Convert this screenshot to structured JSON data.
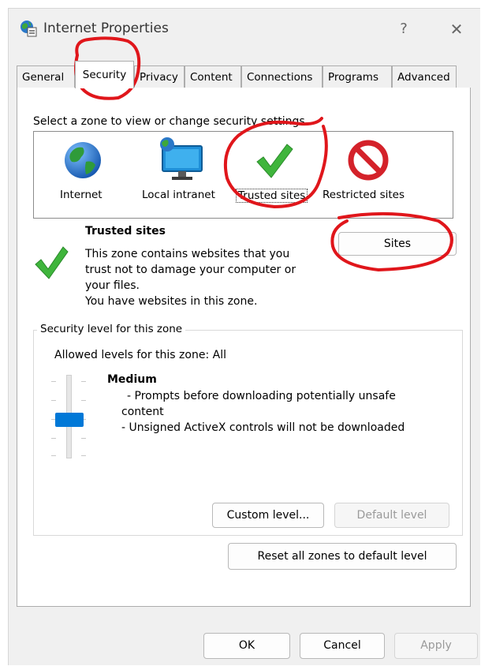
{
  "window": {
    "title": "Internet Properties",
    "help_glyph": "?",
    "close_glyph": "✕",
    "icon": "globe-internet-options-icon"
  },
  "tabs": [
    {
      "label": "General",
      "active": false
    },
    {
      "label": "Security",
      "active": true
    },
    {
      "label": "Privacy",
      "active": false
    },
    {
      "label": "Content",
      "active": false
    },
    {
      "label": "Connections",
      "active": false
    },
    {
      "label": "Programs",
      "active": false
    },
    {
      "label": "Advanced",
      "active": false
    }
  ],
  "security": {
    "zone_prompt": "Select a zone to view or change security settings.",
    "zones": [
      {
        "label": "Internet",
        "icon": "globe-icon"
      },
      {
        "label": "Local intranet",
        "icon": "intranet-monitor-icon"
      },
      {
        "label": "Trusted sites",
        "icon": "green-checkmark-icon",
        "selected": true
      },
      {
        "label": "Restricted sites",
        "icon": "no-entry-icon"
      }
    ],
    "selected_zone": {
      "name": "Trusted sites",
      "description_lines": [
        "This zone contains websites that you",
        "trust not to damage your computer or",
        "your files.",
        "You have websites in this zone."
      ]
    },
    "sites_button": "Sites",
    "level_group_title": "Security level for this zone",
    "allowed_levels": "Allowed levels for this zone: All",
    "level": {
      "name": "Medium",
      "lines": [
        "- Prompts before downloading potentially unsafe",
        "content",
        "- Unsigned ActiveX controls will not be downloaded"
      ],
      "slider_position": "medium"
    },
    "custom_level_button": "Custom level...",
    "default_level_button": "Default level",
    "reset_button": "Reset all zones to default level"
  },
  "footer": {
    "ok": "OK",
    "cancel": "Cancel",
    "apply": "Apply"
  },
  "colors": {
    "annotation_red": "#e0161b",
    "slider_thumb": "#0078d7"
  }
}
